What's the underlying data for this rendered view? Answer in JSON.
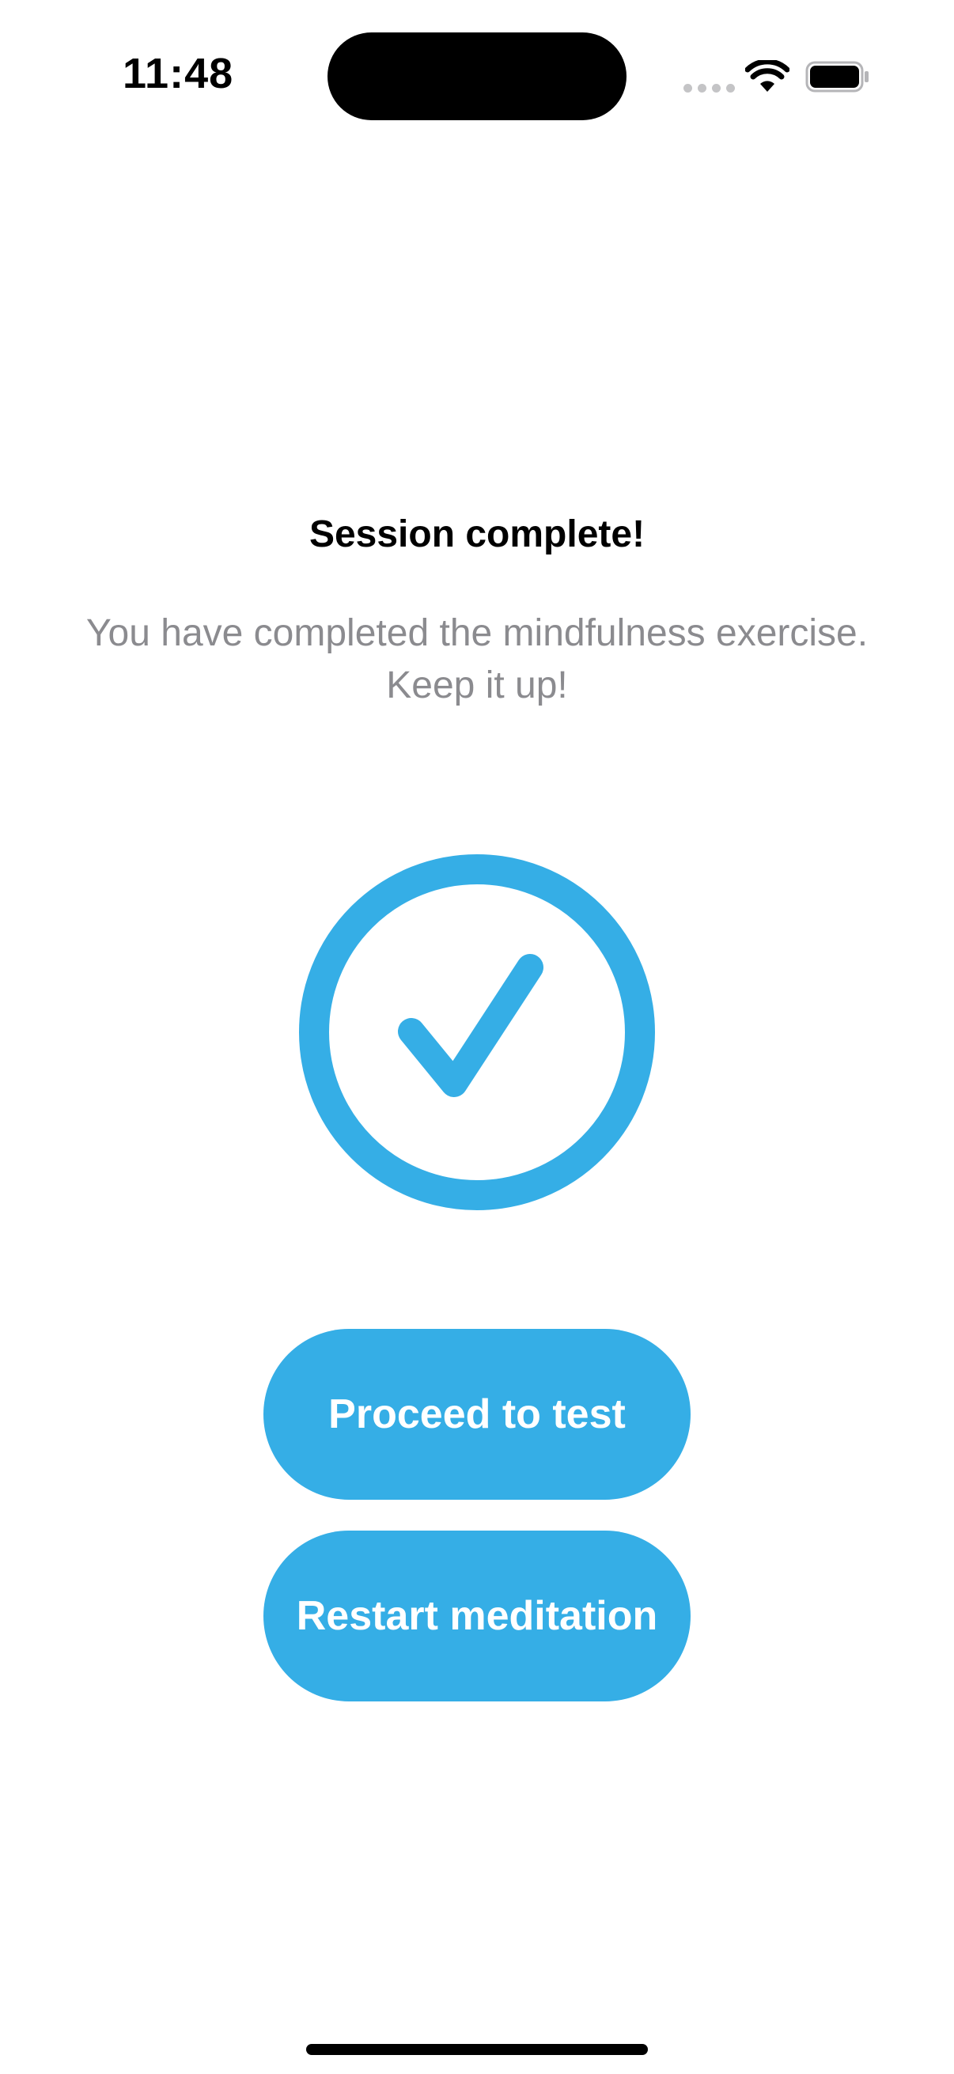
{
  "status_bar": {
    "time": "11:48",
    "icons": [
      "signal-dots-icon",
      "wifi-icon",
      "battery-icon"
    ]
  },
  "content": {
    "title": "Session complete!",
    "subtitle": "You have completed the mindfulness exercise. Keep it up!",
    "status_icon": "checkmark-circle-icon"
  },
  "buttons": {
    "proceed_label": "Proceed to test",
    "restart_label": "Restart meditation"
  },
  "colors": {
    "accent": "#35aee6",
    "subtitle_text": "#8b8b8f",
    "background": "#ffffff"
  }
}
